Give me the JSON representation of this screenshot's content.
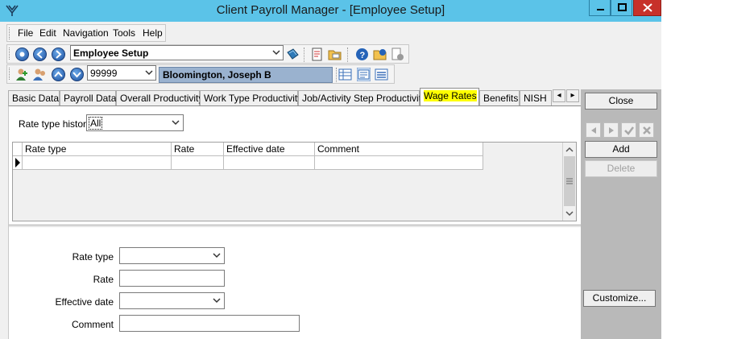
{
  "window": {
    "title": "Client Payroll Manager - [Employee Setup]",
    "accent": "#5bc3e8",
    "close_color": "#c7312a"
  },
  "menu": [
    "File",
    "Edit",
    "Navigation",
    "Tools",
    "Help"
  ],
  "toolbar": {
    "screen_select": "Employee Setup",
    "employee_id": "99999",
    "employee_name": "Bloomington, Joseph B"
  },
  "tabs": [
    "Basic Data",
    "Payroll Data",
    "Overall Productivity",
    "Work Type Productivity",
    "Job/Activity Step Productivity",
    "Wage Rates",
    "Benefits",
    "NISH"
  ],
  "active_tab": "Wage Rates",
  "filter": {
    "label": "Rate type history",
    "value": "All"
  },
  "grid": {
    "columns": [
      "Rate type",
      "Rate",
      "Effective date",
      "Comment"
    ],
    "rows": []
  },
  "form": {
    "rate_type_label": "Rate type",
    "rate_label": "Rate",
    "effective_date_label": "Effective date",
    "comment_label": "Comment"
  },
  "side_panel": {
    "close": "Close",
    "add": "Add",
    "delete": "Delete",
    "customize": "Customize..."
  }
}
